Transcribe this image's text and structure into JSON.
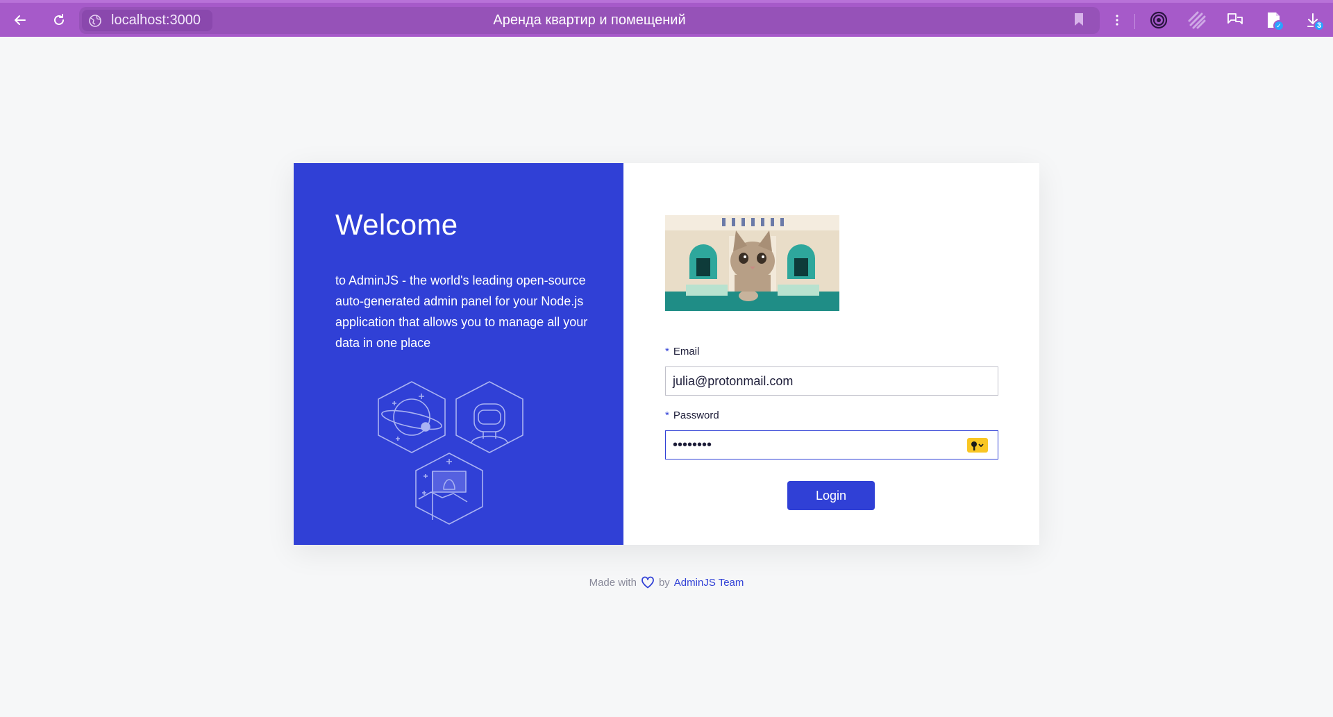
{
  "browser": {
    "url": "localhost:3000",
    "tab_title": "Аренда квартир и помещений",
    "downloads_badge": "3",
    "icons": [
      "back-icon",
      "reload-icon",
      "globe-icon",
      "bookmark-icon",
      "menu-dots-icon",
      "target-icon",
      "stripes-icon",
      "chat-icon",
      "extension-icon",
      "downloads-icon"
    ]
  },
  "welcome": {
    "title": "Welcome",
    "text": "to AdminJS - the world's leading open-source auto-generated admin panel for your Node.js application that allows you to manage all your data in one place"
  },
  "form": {
    "required_mark": "*",
    "email_label": "Email",
    "email_value": "julia@protonmail.com",
    "password_label": "Password",
    "password_value": "••••••••",
    "login_label": "Login"
  },
  "footer": {
    "made_with": "Made with",
    "by": "by",
    "team": "AdminJS Team"
  },
  "colors": {
    "browser_bar": "#a65ac9",
    "primary": "#3040d6",
    "background": "#f6f7f8",
    "key_button": "#f9c623"
  }
}
